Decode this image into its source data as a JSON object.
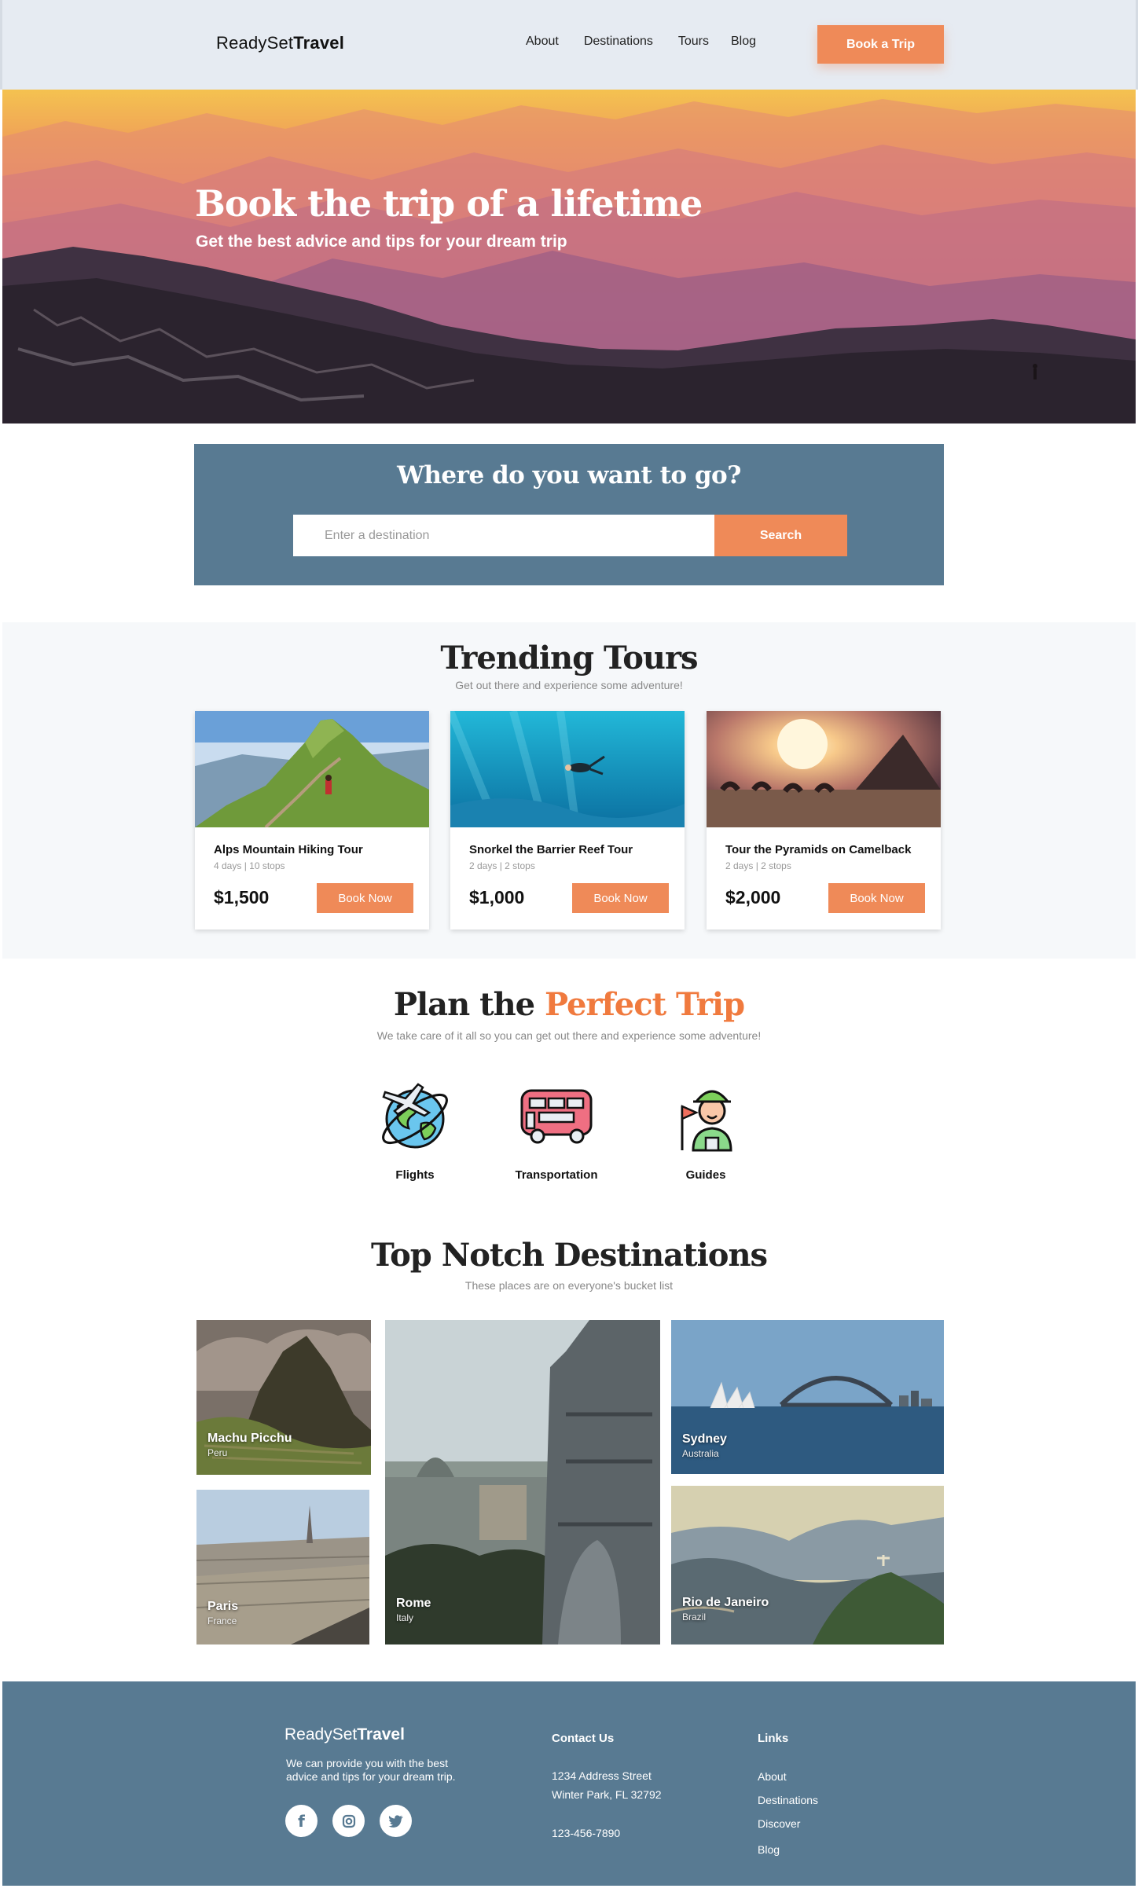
{
  "header": {
    "logo_light": "ReadySet",
    "logo_bold": "Travel",
    "nav": [
      "About",
      "Destinations",
      "Tours",
      "Blog"
    ],
    "cta": "Book a Trip"
  },
  "hero": {
    "title": "Book the trip of a lifetime",
    "subtitle": "Get the best advice and tips for your dream trip"
  },
  "search": {
    "title": "Where do you want to go?",
    "placeholder": "Enter a destination",
    "button": "Search"
  },
  "trending": {
    "title": "Trending Tours",
    "subtitle": "Get out there and experience some adventure!",
    "tours": [
      {
        "name": "Alps Mountain Hiking Tour",
        "meta": "4 days | 10 stops",
        "price": "$1,500",
        "button": "Book Now"
      },
      {
        "name": "Snorkel the Barrier Reef Tour",
        "meta": "2 days | 2 stops",
        "price": "$1,000",
        "button": "Book Now"
      },
      {
        "name": "Tour the Pyramids on Camelback",
        "meta": "2 days | 2 stops",
        "price": "$2,000",
        "button": "Book Now"
      }
    ]
  },
  "plan": {
    "title_plain": "Plan the ",
    "title_accent": "Perfect Trip",
    "subtitle": "We take care of it all so you can get out there and experience some adventure!",
    "services": [
      {
        "label": "Flights",
        "icon": "globe-plane-icon"
      },
      {
        "label": "Transportation",
        "icon": "bus-icon"
      },
      {
        "label": "Guides",
        "icon": "tour-guide-icon"
      }
    ]
  },
  "destinations": {
    "title": "Top Notch Destinations",
    "subtitle": "These places are on everyone's bucket list",
    "places": [
      {
        "name": "Machu Picchu",
        "country": "Peru"
      },
      {
        "name": "Paris",
        "country": "France"
      },
      {
        "name": "Rome",
        "country": "Italy"
      },
      {
        "name": "Sydney",
        "country": "Australia"
      },
      {
        "name": "Rio de Janeiro",
        "country": "Brazil"
      }
    ]
  },
  "footer": {
    "logo_light": "ReadySet",
    "logo_bold": "Travel",
    "description": "We can provide you with the best advice and tips for your dream trip.",
    "contact_title": "Contact Us",
    "address_line1": "1234 Address Street",
    "address_line2": "Winter Park, FL 32792",
    "phone": "123-456-7890",
    "links_title": "Links",
    "links": [
      "About",
      "Destinations",
      "Discover",
      "Blog"
    ],
    "social": [
      "facebook-icon",
      "instagram-icon",
      "twitter-icon"
    ]
  },
  "colors": {
    "accent": "#ef8a58",
    "panel": "#587a92",
    "header_bg": "#e6ebf2"
  }
}
